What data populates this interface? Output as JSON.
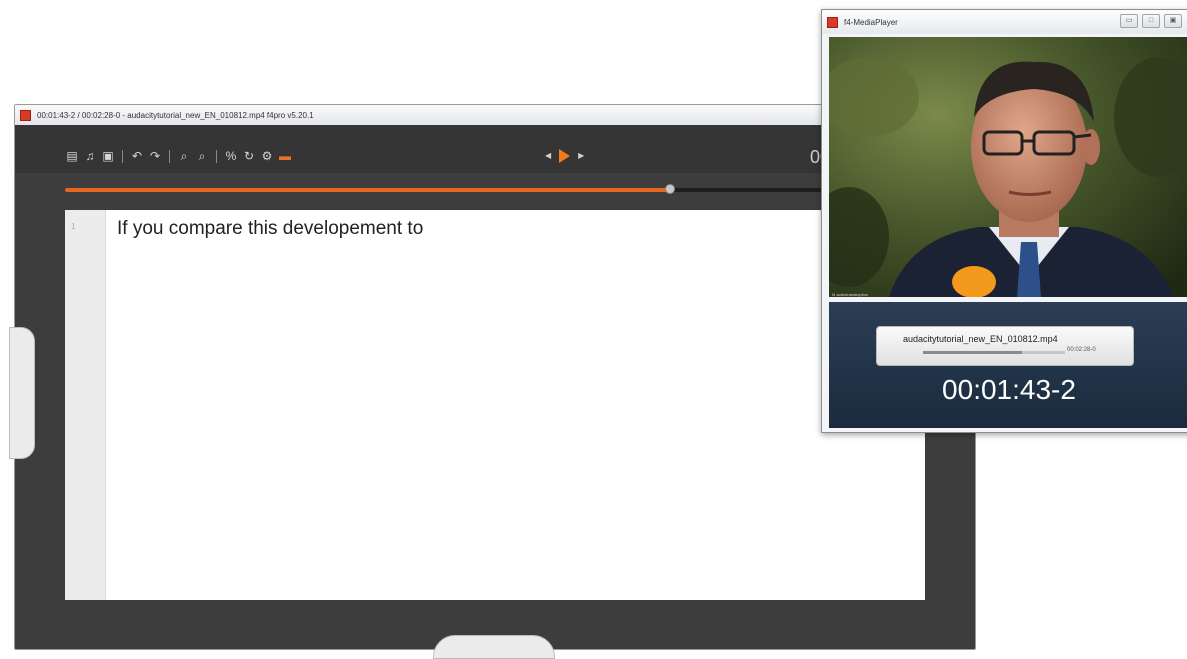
{
  "main_window": {
    "title": "00:01:43-2 / 00:02:28-0 - audacitytutorial_new_EN_010812.mp4 f4pro v5.20.1",
    "time_display": "00",
    "editor": {
      "line_number": "1",
      "text": "If you compare this developement to"
    },
    "playback_progress_fraction": 0.68
  },
  "media_player": {
    "title": "f4-MediaPlayer",
    "filename": "audacitytutorial_new_EN_010812.mp4",
    "duration": "00:02:28-0",
    "current_time": "00:01:43-2",
    "progress_fraction": 0.7,
    "video_caption": "f4 audiotranskription"
  },
  "colors": {
    "accent": "#e4661f",
    "toolbar_bg": "#353535",
    "player_panel": "#22344a"
  }
}
